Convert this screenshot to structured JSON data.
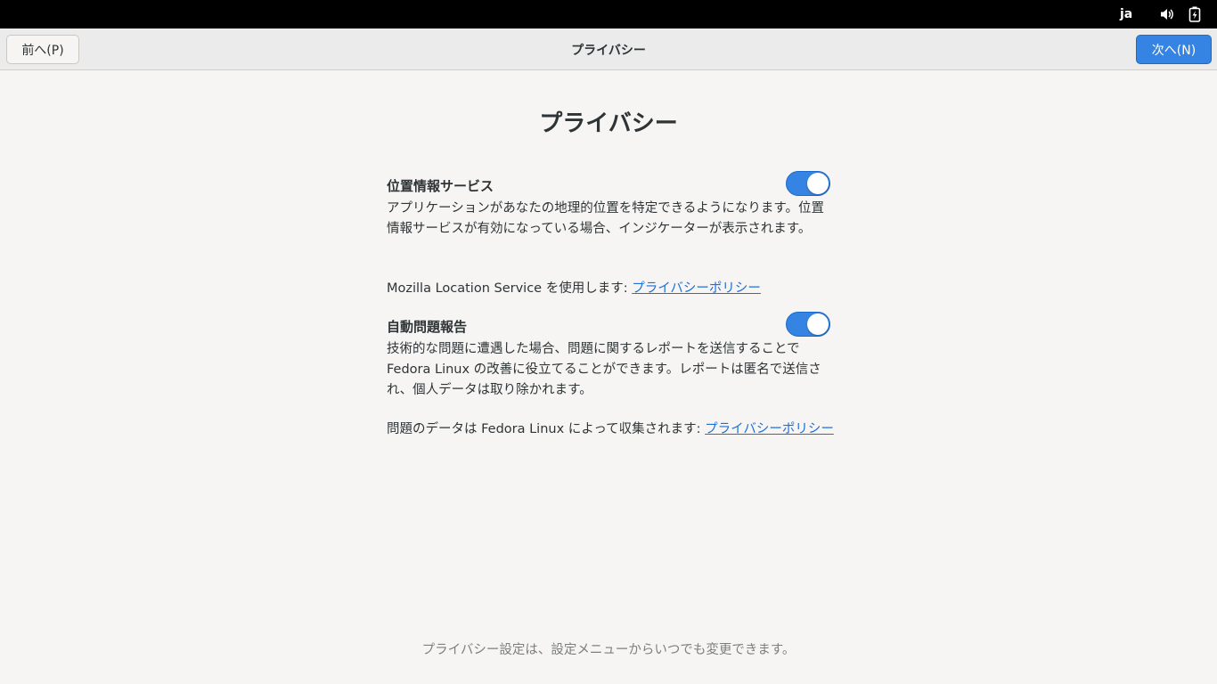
{
  "topbar": {
    "language": "ja",
    "volume_icon": "volume-icon",
    "battery_icon": "battery-charging-icon"
  },
  "header": {
    "prev_label": "前へ(P)",
    "title": "プライバシー",
    "next_label": "次へ(N)"
  },
  "page": {
    "title": "プライバシー"
  },
  "location": {
    "heading": "位置情報サービス",
    "enabled": true,
    "description": "アプリケーションがあなたの地理的位置を特定できるようになります。位置情報サービスが有効になっている場合、インジケーターが表示されます。",
    "provider_text": "Mozilla Location Service を使用します: ",
    "policy_link": "プライバシーポリシー"
  },
  "problem_reporting": {
    "heading": "自動問題報告",
    "enabled": true,
    "description": "技術的な問題に遭遇した場合、問題に関するレポートを送信することでFedora Linux の改善に役立てることができます。レポートは匿名で送信され、個人データは取り除かれます。",
    "collector_text": "問題のデータは Fedora Linux によって収集されます: ",
    "policy_link": "プライバシーポリシー"
  },
  "footer": {
    "note": "プライバシー設定は、設定メニューからいつでも変更できます。"
  },
  "colors": {
    "accent": "#3584e4",
    "link": "#1c71d8",
    "background": "#f6f5f4"
  }
}
